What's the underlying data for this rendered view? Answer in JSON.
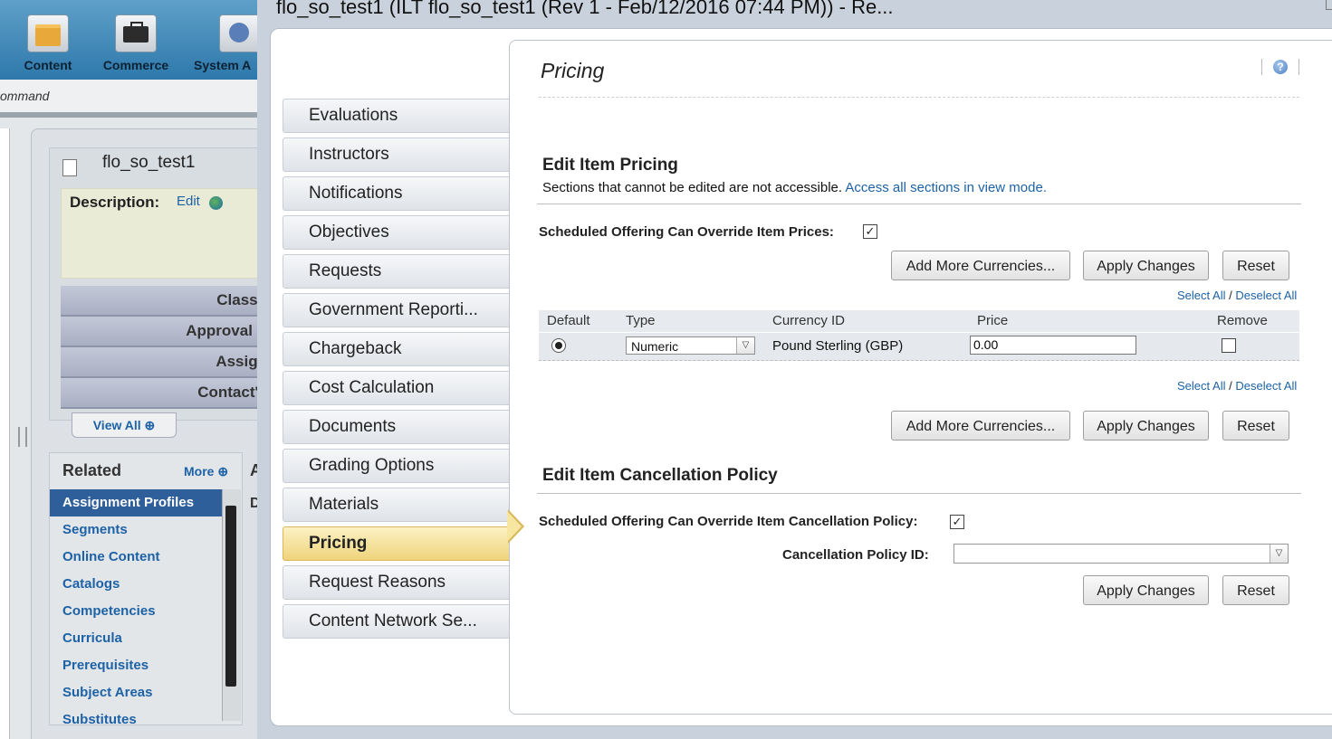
{
  "app": {
    "toolbar": [
      "Content",
      "Commerce",
      "System A"
    ],
    "command_label": "ommand",
    "item_title": "flo_so_test1",
    "description_label": "Description:",
    "description_edit": "Edit",
    "accordion": [
      "Classif",
      "Approval P",
      "Assign",
      "Contact's"
    ],
    "view_all": "View All",
    "related": {
      "heading": "Related",
      "more": "More",
      "items": [
        "Assignment Profiles",
        "Segments",
        "Online Content",
        "Catalogs",
        "Competencies",
        "Curricula",
        "Prerequisites",
        "Subject Areas",
        "Substitutes"
      ]
    },
    "side_a": "A",
    "side_d": "D"
  },
  "modal": {
    "title": "flo_so_test1 (ILT flo_so_test1 (Rev 1 - Feb/12/2016 07:44 PM)) - Re...",
    "nav": [
      "Evaluations",
      "Instructors",
      "Notifications",
      "Objectives",
      "Requests",
      "Government Reporti...",
      "Chargeback",
      "Cost Calculation",
      "Documents",
      "Grading Options",
      "Materials",
      "Pricing",
      "Request Reasons",
      "Content Network Se..."
    ],
    "active_nav": "Pricing",
    "page_title": "Pricing",
    "help_icon": "?",
    "pricing": {
      "heading": "Edit Item Pricing",
      "note": "Sections that cannot be edited are not accessible.",
      "note_link": "Access all sections in view mode.",
      "override_label": "Scheduled Offering Can Override Item Prices:",
      "override_checked": "✓",
      "add_currencies": "Add More Currencies...",
      "apply": "Apply Changes",
      "reset": "Reset",
      "select_all": "Select All",
      "slash": "/",
      "deselect_all": "Deselect All",
      "columns": [
        "Default",
        "Type",
        "Currency ID",
        "Price",
        "Remove"
      ],
      "row": {
        "type": "Numeric",
        "currency": "Pound Sterling (GBP)",
        "price": "0.00"
      }
    },
    "cancellation": {
      "heading": "Edit Item Cancellation Policy",
      "override_label": "Scheduled Offering Can Override Item Cancellation Policy:",
      "override_checked": "✓",
      "policy_label": "Cancellation Policy ID:",
      "policy_value": "",
      "apply": "Apply Changes",
      "reset": "Reset"
    }
  }
}
